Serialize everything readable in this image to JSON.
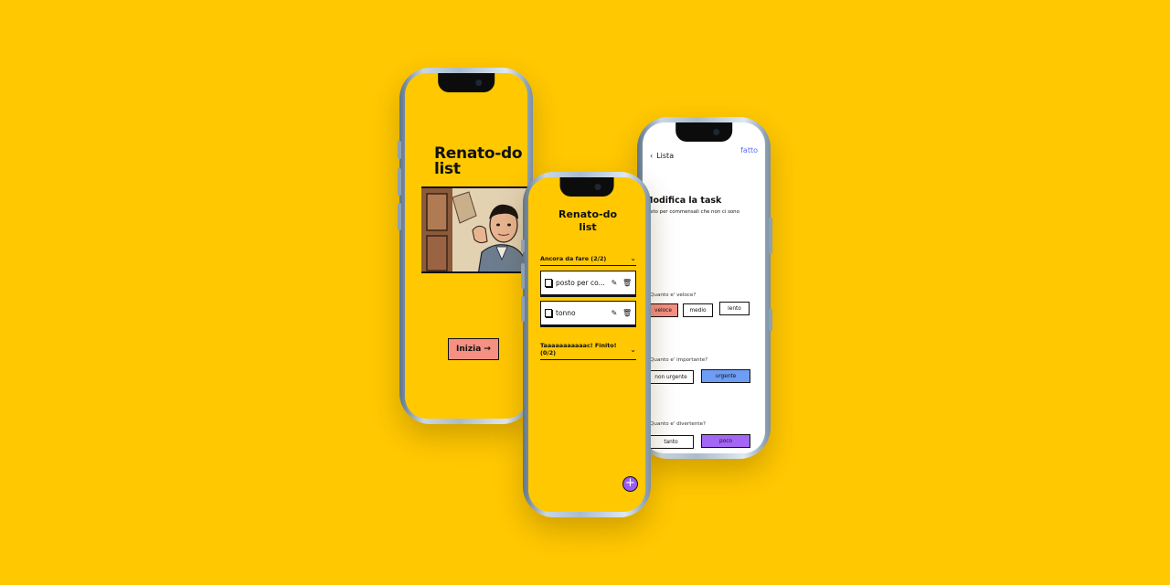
{
  "phone1": {
    "app_title": "Renato-do list",
    "start_button": "Inizia →"
  },
  "phone2": {
    "list_title": "Renato-do list",
    "todo_section": "Ancora da fare (2/2)",
    "tasks": [
      {
        "text": "posto per co..."
      },
      {
        "text": "tonno"
      }
    ],
    "done_section": "Taaaaaaaaaaac! Finito! (0/2)",
    "add_button": "+"
  },
  "phone3": {
    "back_label": "Lista",
    "done_label": "fatto",
    "title": "Modifica la task",
    "subtitle": "posto per commensali che non ci sono",
    "questions": [
      {
        "label": "Quanto e' veloce?",
        "options": [
          "veloce",
          "medio",
          "lento"
        ],
        "selected": "veloce"
      },
      {
        "label": "Quanto e' importante?",
        "options": [
          "non urgente",
          "urgente"
        ],
        "selected": "urgente"
      },
      {
        "label": "Quanto e' divertente?",
        "options": [
          "tanto",
          "poco"
        ],
        "selected": "poco"
      }
    ]
  },
  "colors": {
    "background": "#FFC800",
    "accent_red": "#F59082",
    "accent_blue": "#6E9DF5",
    "accent_purple": "#A466F5",
    "link_blue": "#5B6CF0"
  }
}
